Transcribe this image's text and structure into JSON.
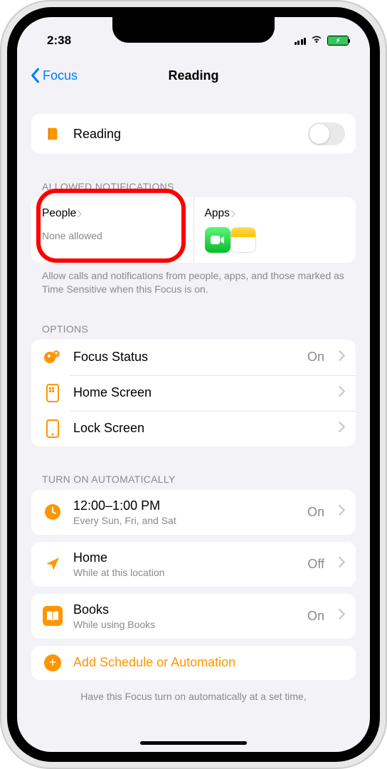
{
  "status": {
    "time": "2:38"
  },
  "nav": {
    "back": "Focus",
    "title": "Reading"
  },
  "focus": {
    "name": "Reading"
  },
  "sections": {
    "allowed": {
      "header": "ALLOWED NOTIFICATIONS",
      "people": {
        "title": "People",
        "sub": "None allowed"
      },
      "apps": {
        "title": "Apps"
      },
      "footer": "Allow calls and notifications from people, apps, and those marked as Time Sensitive when this Focus is on."
    },
    "options": {
      "header": "OPTIONS",
      "focusStatus": {
        "label": "Focus Status",
        "value": "On"
      },
      "homeScreen": {
        "label": "Home Screen"
      },
      "lockScreen": {
        "label": "Lock Screen"
      }
    },
    "auto": {
      "header": "TURN ON AUTOMATICALLY",
      "schedule": {
        "label": "12:00–1:00 PM",
        "sub": "Every Sun, Fri, and Sat",
        "value": "On"
      },
      "location": {
        "label": "Home",
        "sub": "While at this location",
        "value": "Off"
      },
      "app": {
        "label": "Books",
        "sub": "While using Books",
        "value": "On"
      },
      "add": "Add Schedule or Automation",
      "footer": "Have this Focus turn on automatically at a set time,"
    }
  }
}
